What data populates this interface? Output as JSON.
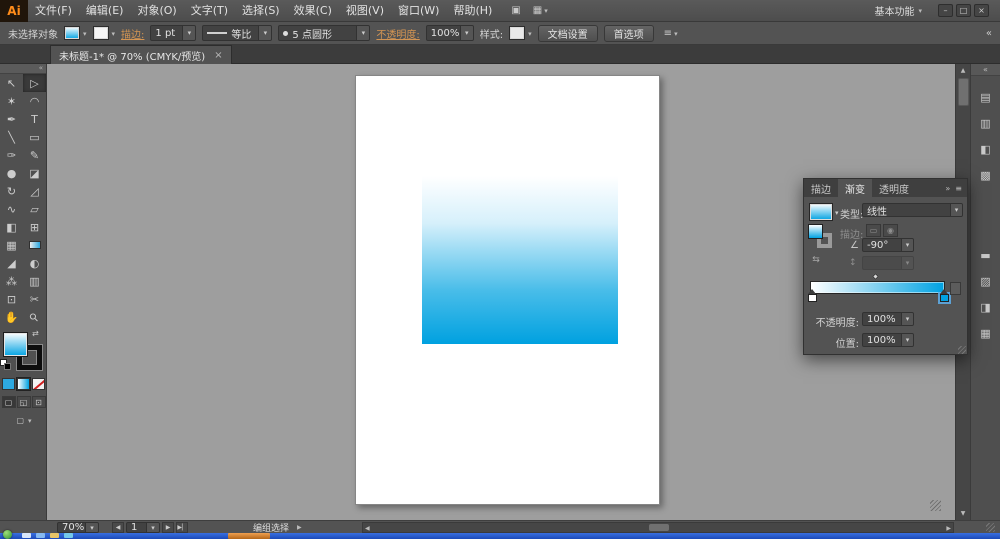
{
  "menubar": {
    "logo": "Ai",
    "items": [
      "文件(F)",
      "编辑(E)",
      "对象(O)",
      "文字(T)",
      "选择(S)",
      "效果(C)",
      "视图(V)",
      "窗口(W)",
      "帮助(H)"
    ],
    "icons": [
      {
        "name": "go-to-bridge-icon",
        "glyph": "▣"
      },
      {
        "name": "arrange-documents-icon",
        "glyph": "▦"
      }
    ],
    "workspace": "基本功能",
    "controls": {
      "minimize": "–",
      "restore": "□",
      "close": "×"
    }
  },
  "controlbar": {
    "selection_status": "未选择对象",
    "stroke_label": "描边:",
    "stroke_width": "1 pt",
    "profile": "等比",
    "brush_name": "5 点圆形",
    "opacity_label": "不透明度:",
    "opacity_value": "100%",
    "style_label": "样式:",
    "document_setup_button": "文档设置",
    "preferences_button": "首选项",
    "panel_menu_glyph": "≡",
    "dock_toggle_glyph": "«"
  },
  "document_tab": {
    "title": "未标题-1* @ 70% (CMYK/预览)",
    "close": "×"
  },
  "tools": [
    {
      "name": "selection-tool",
      "glyph": "↖"
    },
    {
      "name": "direct-selection-tool",
      "glyph": "▷"
    },
    {
      "name": "magic-wand-tool",
      "glyph": "✶"
    },
    {
      "name": "lasso-tool",
      "glyph": "◠"
    },
    {
      "name": "pen-tool",
      "glyph": "✒"
    },
    {
      "name": "type-tool",
      "glyph": "T"
    },
    {
      "name": "line-segment-tool",
      "glyph": "╲"
    },
    {
      "name": "rectangle-tool",
      "glyph": "▭"
    },
    {
      "name": "paintbrush-tool",
      "glyph": "✑"
    },
    {
      "name": "pencil-tool",
      "glyph": "✎"
    },
    {
      "name": "blob-brush-tool",
      "glyph": "●"
    },
    {
      "name": "eraser-tool",
      "glyph": "◪"
    },
    {
      "name": "rotate-tool",
      "glyph": "↻"
    },
    {
      "name": "scale-tool",
      "glyph": "◿"
    },
    {
      "name": "width-tool",
      "glyph": "∿"
    },
    {
      "name": "free-transform-tool",
      "glyph": "▱"
    },
    {
      "name": "shape-builder-tool",
      "glyph": "◧"
    },
    {
      "name": "perspective-grid-tool",
      "glyph": "⊞"
    },
    {
      "name": "mesh-tool",
      "glyph": "▦"
    },
    {
      "name": "gradient-tool",
      "glyph": ""
    },
    {
      "name": "eyedropper-tool",
      "glyph": "◢"
    },
    {
      "name": "blend-tool",
      "glyph": "◐"
    },
    {
      "name": "symbol-sprayer-tool",
      "glyph": "⁂"
    },
    {
      "name": "column-graph-tool",
      "glyph": "▥"
    },
    {
      "name": "artboard-tool",
      "glyph": "⊡"
    },
    {
      "name": "slice-tool",
      "glyph": "✂"
    },
    {
      "name": "hand-tool",
      "glyph": "✋"
    },
    {
      "name": "zoom-tool",
      "glyph": "⚲"
    }
  ],
  "toolbar_controls": {
    "swap_glyph": "⇄",
    "draw_modes": [
      {
        "name": "draw-normal-mode",
        "glyph": "▢"
      },
      {
        "name": "draw-behind-mode",
        "glyph": "◱"
      },
      {
        "name": "draw-inside-mode",
        "glyph": "⊡"
      }
    ],
    "screen_mode_glyph": "▢"
  },
  "gradient_panel": {
    "tabs": [
      "描边",
      "渐变",
      "透明度"
    ],
    "active_tab": "渐变",
    "flyout_collapse_glyph": "»",
    "flyout_menu_glyph": "≡",
    "type_label": "类型:",
    "type_value": "线性",
    "stroke_label": "描边:",
    "stroke_buttons": [
      "▭",
      "◉"
    ],
    "angle_symbol": "∠",
    "angle_value": "-90°",
    "aspect_glyph": "↕",
    "reverse_glyph": "⇆",
    "opacity_label": "不透明度:",
    "opacity_value": "100%",
    "position_label": "位置:",
    "position_value": "100%",
    "gradient": {
      "type": "linear",
      "angle_degrees": -90,
      "stops": [
        {
          "color": "#FFFFFF",
          "position_percent": 0
        },
        {
          "color": "#00A2E2",
          "position_percent": 100,
          "selected": true
        }
      ],
      "midpoint_percent": 48
    }
  },
  "dock": {
    "expand_glyph": "«",
    "icons": [
      {
        "name": "color-panel-icon",
        "glyph": "▤"
      },
      {
        "name": "color-guide-panel-icon",
        "glyph": "▥"
      },
      {
        "name": "appearance-panel-icon",
        "glyph": "◧"
      },
      {
        "name": "graphic-styles-panel-icon",
        "glyph": "▩"
      },
      {
        "name": "stroke-panel-icon",
        "glyph": "▬"
      },
      {
        "name": "gradient-panel-icon",
        "glyph": "▨"
      },
      {
        "name": "transparency-panel-icon",
        "glyph": "◨"
      },
      {
        "name": "layers-panel-icon",
        "glyph": "▦"
      }
    ]
  },
  "canvas": {
    "rectangle_fill_top": "#FFFFFF",
    "rectangle_fill_bottom": "#00A1E0"
  },
  "statusbar": {
    "zoom": "70%",
    "artboard_number": "1",
    "tool_status": "编组选择"
  },
  "colors": {
    "ui_panel": "#535353",
    "ui_dark": "#3E3E3E",
    "pasteboard": "#9E9E9E",
    "accent_blue": "#00A2E2",
    "link_orange": "#D49553",
    "taskbar_blue": "#2353C4",
    "taskbar_active_orange": "#C87A28"
  }
}
